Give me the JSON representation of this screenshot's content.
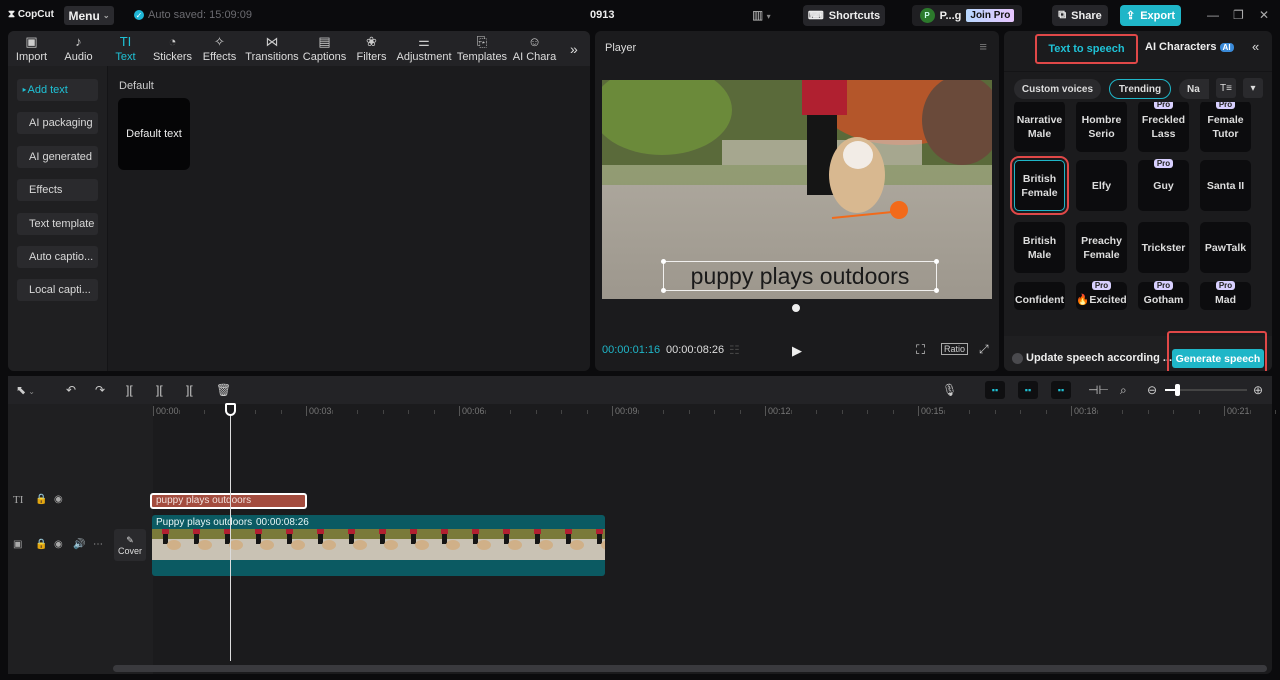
{
  "app": {
    "logo": "CopCut",
    "menu_label": "Menu",
    "autosave": "Auto saved: 15:09:09",
    "project_title": "0913"
  },
  "titlebar": {
    "shortcuts_label": "Shortcuts",
    "user_initial": "P",
    "user_name": "P...g",
    "join_pro_label": "Join Pro",
    "share_label": "Share",
    "export_label": "Export"
  },
  "toolbar": {
    "items": [
      {
        "label": "Import",
        "icon": "import-icon"
      },
      {
        "label": "Audio",
        "icon": "audio-icon"
      },
      {
        "label": "Text",
        "icon": "text-icon",
        "active": true
      },
      {
        "label": "Stickers",
        "icon": "sticker-icon"
      },
      {
        "label": "Effects",
        "icon": "effects-icon"
      },
      {
        "label": "Transitions",
        "icon": "transitions-icon"
      },
      {
        "label": "Captions",
        "icon": "captions-icon"
      },
      {
        "label": "Filters",
        "icon": "filters-icon"
      },
      {
        "label": "Adjustment",
        "icon": "adjustment-icon"
      },
      {
        "label": "Templates",
        "icon": "templates-icon"
      },
      {
        "label": "AI Chara",
        "icon": "ai-character-icon"
      }
    ]
  },
  "text_sidebar": {
    "items": [
      "Add text",
      "AI packaging",
      "AI generated",
      "Effects",
      "Text template",
      "Auto captio...",
      "Local capti..."
    ]
  },
  "text_content": {
    "section_label": "Default",
    "card_label": "Default text"
  },
  "player": {
    "title": "Player",
    "caption": "puppy plays outdoors",
    "current_time": "00:00:01:16",
    "total_time": "00:00:08:26",
    "ratio_label": "Ratio"
  },
  "tts": {
    "tab_tts": "Text to speech",
    "tab_ai": "AI Characters",
    "ai_badge": "AI",
    "chips": [
      "Custom voices",
      "Trending",
      "Na"
    ],
    "voices": [
      {
        "name": "Narrative\nMale",
        "pro": false
      },
      {
        "name": "Hombre\nSerio",
        "pro": false
      },
      {
        "name": "Freckled\nLass",
        "pro": true
      },
      {
        "name": "Female\nTutor",
        "pro": true
      },
      {
        "name": "British\nFemale",
        "pro": false,
        "selected": true
      },
      {
        "name": "Elfy",
        "pro": false
      },
      {
        "name": "Guy",
        "pro": true
      },
      {
        "name": "Santa II",
        "pro": false
      },
      {
        "name": "British\nMale",
        "pro": false
      },
      {
        "name": "Preachy\nFemale",
        "pro": false
      },
      {
        "name": "Trickster",
        "pro": false
      },
      {
        "name": "PawTalk",
        "pro": false
      },
      {
        "name": "Confident",
        "pro": false
      },
      {
        "name": "🔥Excited",
        "pro": true
      },
      {
        "name": "Gotham",
        "pro": true
      },
      {
        "name": "Mad",
        "pro": true
      }
    ],
    "pro_label": "Pro",
    "update_label": "Update speech according ...",
    "generate_label": "Generate speech"
  },
  "timeline": {
    "ticks": [
      "00:00",
      "00:03",
      "00:06",
      "00:09",
      "00:12",
      "00:15",
      "00:18",
      "00:21"
    ],
    "text_clip_label": "puppy plays outdoors",
    "video_clip_label": "Puppy plays outdoors",
    "video_clip_duration": "00:00:08:26",
    "cover_label": "Cover"
  },
  "colors": {
    "accent": "#1fb6c8",
    "highlight": "#e04848",
    "text_clip": "#a34c3e",
    "video_clip": "#0b5a62"
  }
}
